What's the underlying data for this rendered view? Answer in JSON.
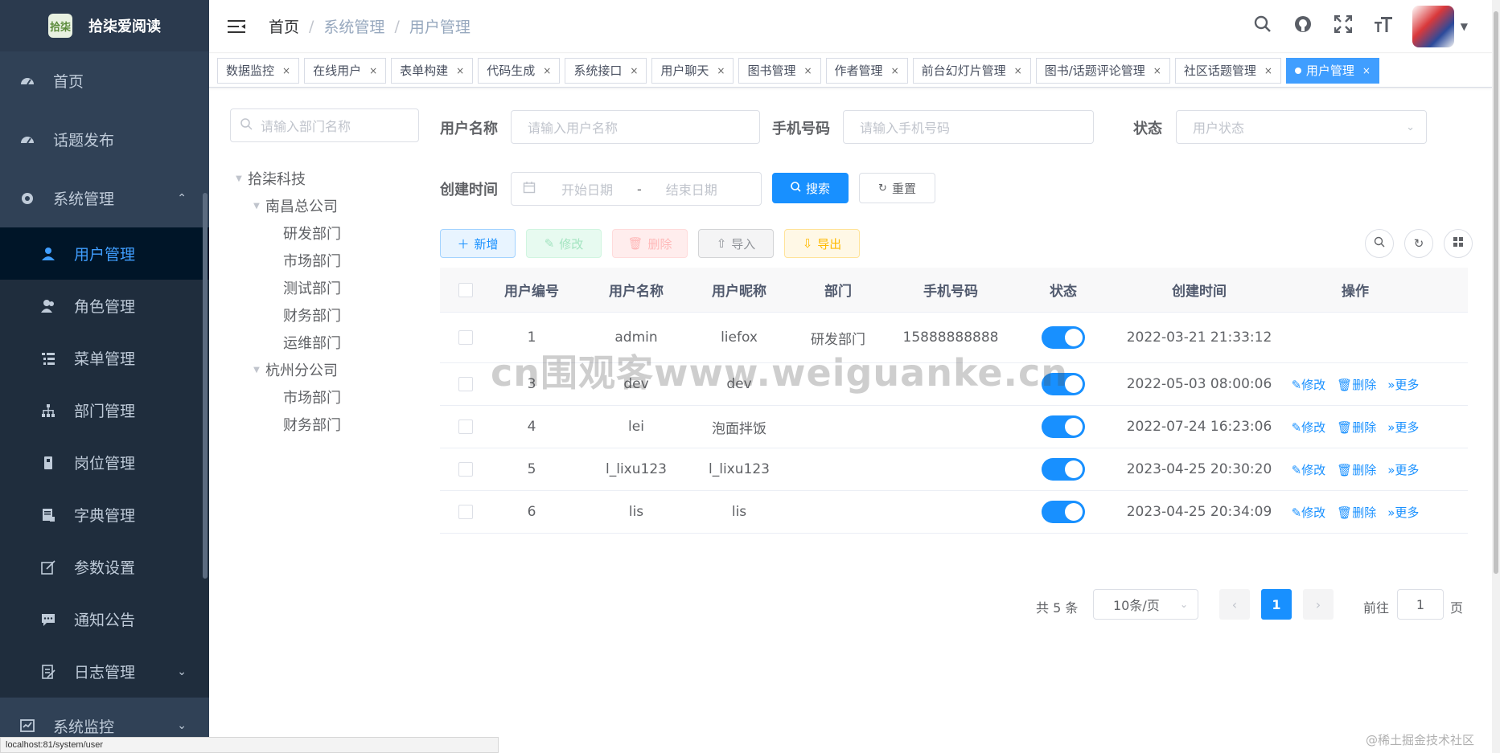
{
  "logo": {
    "badge": "拾柒",
    "title": "拾柒爱阅读"
  },
  "sidebar": {
    "items": [
      {
        "label": "首页",
        "icon": "dashboard-icon"
      },
      {
        "label": "话题发布",
        "icon": "dashboard-icon"
      },
      {
        "label": "系统管理",
        "icon": "gear-icon"
      }
    ],
    "sub_items": [
      {
        "label": "用户管理",
        "icon": "user-icon"
      },
      {
        "label": "角色管理",
        "icon": "peoples-icon"
      },
      {
        "label": "菜单管理",
        "icon": "tree-table-icon"
      },
      {
        "label": "部门管理",
        "icon": "tree-icon"
      },
      {
        "label": "岗位管理",
        "icon": "post-icon"
      },
      {
        "label": "字典管理",
        "icon": "dict-icon"
      },
      {
        "label": "参数设置",
        "icon": "edit-icon"
      },
      {
        "label": "通知公告",
        "icon": "message-icon"
      },
      {
        "label": "日志管理",
        "icon": "log-icon"
      }
    ],
    "bottom": {
      "label": "系统监控",
      "icon": "monitor-icon"
    }
  },
  "status_url": "localhost:81/system/user",
  "breadcrumb": {
    "home": "首页",
    "mid": "系统管理",
    "current": "用户管理"
  },
  "tags": [
    "数据监控",
    "在线用户",
    "表单构建",
    "代码生成",
    "系统接口",
    "用户聊天",
    "图书管理",
    "作者管理",
    "前台幻灯片管理",
    "图书/话题评论管理",
    "社区话题管理",
    "用户管理"
  ],
  "dept": {
    "placeholder": "请输入部门名称",
    "root": "拾柒科技",
    "nanchang": "南昌总公司",
    "nanchang_children": [
      "研发部门",
      "市场部门",
      "测试部门",
      "财务部门",
      "运维部门"
    ],
    "hangzhou": "杭州分公司",
    "hangzhou_children": [
      "市场部门",
      "财务部门"
    ]
  },
  "search": {
    "username_label": "用户名称",
    "username_placeholder": "请输入用户名称",
    "phone_label": "手机号码",
    "phone_placeholder": "请输入手机号码",
    "status_label": "状态",
    "status_placeholder": "用户状态",
    "time_label": "创建时间",
    "start_placeholder": "开始日期",
    "dash": "-",
    "end_placeholder": "结束日期",
    "search_btn": "搜索",
    "reset_btn": "重置"
  },
  "toolbar": {
    "add": "新增",
    "edit": "修改",
    "delete": "删除",
    "import": "导入",
    "export": "导出"
  },
  "table": {
    "headers": [
      "用户编号",
      "用户名称",
      "用户昵称",
      "部门",
      "手机号码",
      "状态",
      "创建时间",
      "操作"
    ],
    "rows": [
      {
        "id": "1",
        "name": "admin",
        "nick": "liefox",
        "dept": "研发部门",
        "phone": "15888888888",
        "enabled": true,
        "time": "2022-03-21 21:33:12",
        "ops": false
      },
      {
        "id": "3",
        "name": "dev",
        "nick": "dev",
        "dept": "",
        "phone": "",
        "enabled": true,
        "time": "2022-05-03 08:00:06",
        "ops": true
      },
      {
        "id": "4",
        "name": "lei",
        "nick": "泡面拌饭",
        "dept": "",
        "phone": "",
        "enabled": true,
        "time": "2022-07-24 16:23:06",
        "ops": true
      },
      {
        "id": "5",
        "name": "l_lixu123",
        "nick": "l_lixu123",
        "dept": "",
        "phone": "",
        "enabled": true,
        "time": "2023-04-25 20:30:20",
        "ops": true
      },
      {
        "id": "6",
        "name": "lis",
        "nick": "lis",
        "dept": "",
        "phone": "",
        "enabled": true,
        "time": "2023-04-25 20:34:09",
        "ops": true
      }
    ],
    "op_edit": "修改",
    "op_delete": "删除",
    "op_more": "更多"
  },
  "pagination": {
    "total": "共 5 条",
    "size": "10条/页",
    "current": "1",
    "goto": "前往",
    "jump": "1",
    "page": "页"
  },
  "watermark": "cn围观客www.weiguanke.cn",
  "credit": "@稀土掘金技术社区",
  "colors": {
    "sidebar": "#304156",
    "primary": "#1890ff",
    "active_menu": "#409eff"
  }
}
